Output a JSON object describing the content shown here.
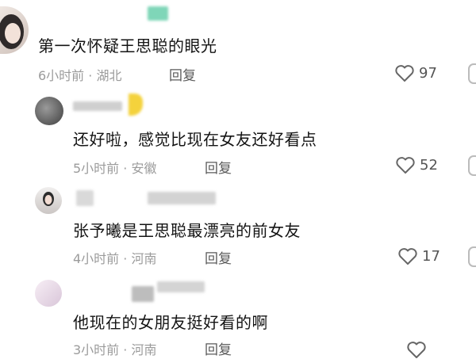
{
  "comments": [
    {
      "username": "",
      "text": "第一次怀疑王思聪的眼光",
      "time": "6小时前",
      "location": "湖北",
      "reply": "回复",
      "likes": "97"
    },
    {
      "username": "",
      "text": "还好啦，感觉比现在女友还好看点",
      "time": "5小时前",
      "location": "安徽",
      "reply": "回复",
      "likes": "52"
    },
    {
      "username": "",
      "text": "张予曦是王思聪最漂亮的前女友",
      "time": "4小时前",
      "location": "河南",
      "reply": "回复",
      "likes": "17"
    },
    {
      "username": "",
      "text": "他现在的女朋友挺好看的啊",
      "time": "3小时前",
      "location": "河南",
      "reply": "回复",
      "likes": ""
    }
  ],
  "separator": " · ",
  "colors": {
    "text": "#141414",
    "meta": "#9b9b9b",
    "heart": "#666666"
  },
  "icons": {
    "like": "heart-outline-icon"
  }
}
